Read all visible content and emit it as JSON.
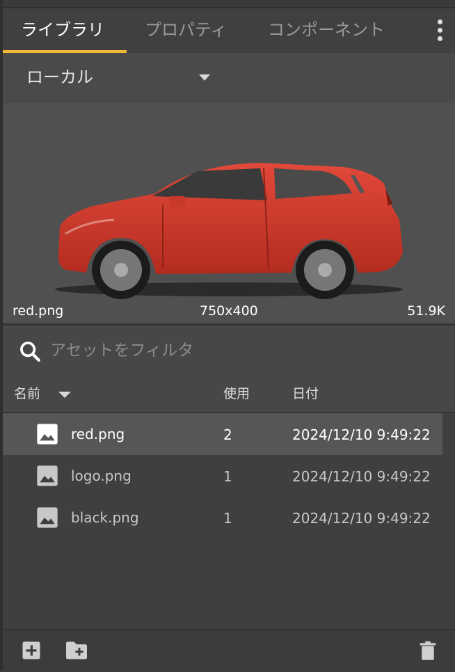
{
  "tabs": [
    {
      "label": "ライブラリ",
      "active": true
    },
    {
      "label": "プロパティ",
      "active": false
    },
    {
      "label": "コンポーネント",
      "active": false
    }
  ],
  "source": {
    "selected": "ローカル"
  },
  "preview": {
    "filename": "red.png",
    "dimensions": "750x400",
    "filesize": "51.9K"
  },
  "filter": {
    "placeholder": "アセットをフィルタ",
    "value": ""
  },
  "table": {
    "headers": {
      "name": "名前",
      "uses": "使用",
      "date": "日付"
    },
    "rows": [
      {
        "name": "red.png",
        "uses": "2",
        "date": "2024/12/10 9:49:22",
        "selected": true
      },
      {
        "name": "logo.png",
        "uses": "1",
        "date": "2024/12/10 9:49:22",
        "selected": false
      },
      {
        "name": "black.png",
        "uses": "1",
        "date": "2024/12/10 9:49:22",
        "selected": false
      }
    ]
  },
  "colors": {
    "accent": "#f2b733",
    "panel": "#3f3f3f",
    "selected_row": "#565656"
  },
  "icons": {
    "menu": "kebab-menu-icon",
    "search": "search-icon",
    "image": "image-icon",
    "add": "add-icon",
    "new_folder": "folder-plus-icon",
    "delete": "trash-icon"
  }
}
